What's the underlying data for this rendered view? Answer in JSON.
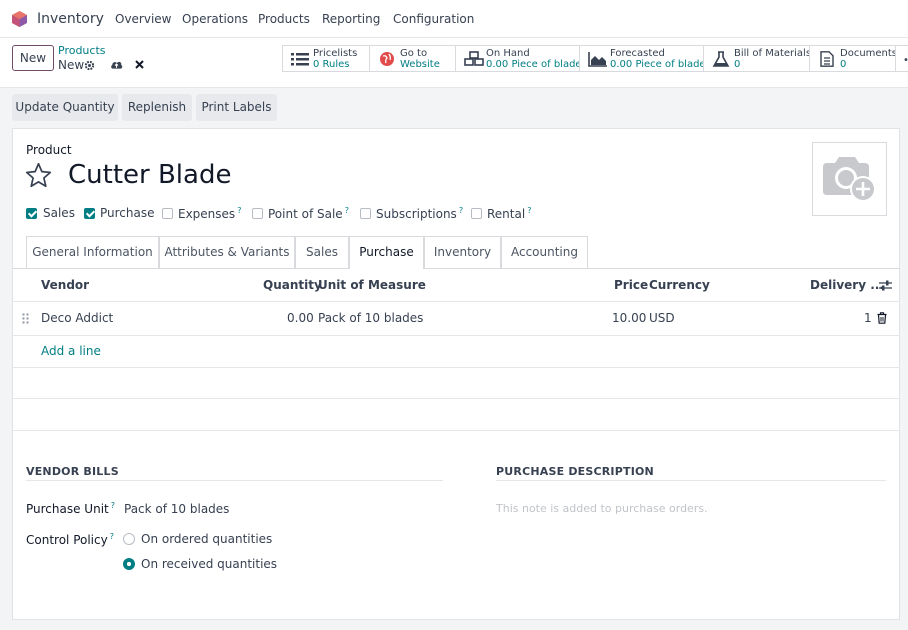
{
  "navbar": {
    "app_name": "Inventory",
    "menu": [
      "Overview",
      "Operations",
      "Products",
      "Reporting",
      "Configuration"
    ]
  },
  "control_panel": {
    "new_label": "New",
    "breadcrumb_parent": "Products",
    "breadcrumb_current": "New"
  },
  "smart_buttons": [
    {
      "title": "Pricelists",
      "value": "0 Rules",
      "icon": "list-icon"
    },
    {
      "title": "Go to",
      "value": "Website",
      "icon": "globe-icon"
    },
    {
      "title": "On Hand",
      "value": "0.00 Piece of blade",
      "icon": "cubes-icon"
    },
    {
      "title": "Forecasted",
      "value": "0.00 Piece of blade",
      "icon": "area-chart-icon"
    },
    {
      "title": "Bill of Materials",
      "value": "0",
      "icon": "flask-icon"
    },
    {
      "title": "Documents",
      "value": "0",
      "icon": "document-icon"
    }
  ],
  "actions": {
    "update_quantity": "Update Quantity",
    "replenish": "Replenish",
    "print_labels": "Print Labels"
  },
  "product": {
    "label": "Product",
    "name": "Cutter Blade",
    "options": [
      {
        "label": "Sales",
        "checked": true,
        "help": false
      },
      {
        "label": "Purchase",
        "checked": true,
        "help": false
      },
      {
        "label": "Expenses",
        "checked": false,
        "help": true
      },
      {
        "label": "Point of Sale",
        "checked": false,
        "help": true
      },
      {
        "label": "Subscriptions",
        "checked": false,
        "help": true
      },
      {
        "label": "Rental",
        "checked": false,
        "help": true
      }
    ],
    "help_mark": "?"
  },
  "tabs": [
    "General Information",
    "Attributes & Variants",
    "Sales",
    "Purchase",
    "Inventory",
    "Accounting"
  ],
  "active_tab": "Purchase",
  "vendor_table": {
    "columns": [
      "Vendor",
      "Quantity",
      "Unit of Measure",
      "Price",
      "Currency",
      "Delivery ..."
    ],
    "rows": [
      {
        "vendor": "Deco Addict",
        "quantity": "0.00",
        "uom": "Pack of 10 blades",
        "price": "10.00",
        "currency": "USD",
        "delivery": "1"
      }
    ],
    "add_line": "Add a line"
  },
  "vendor_bills": {
    "title": "VENDOR BILLS",
    "purchase_unit_label": "Purchase Unit",
    "purchase_unit_value": "Pack of 10 blades",
    "control_policy_label": "Control Policy",
    "policy_options": [
      {
        "label": "On ordered quantities",
        "selected": false
      },
      {
        "label": "On received quantities",
        "selected": true
      }
    ]
  },
  "purchase_description": {
    "title": "PURCHASE DESCRIPTION",
    "placeholder": "This note is added to purchase orders."
  },
  "colors": {
    "accent": "#017e84",
    "brand": "#714b67"
  }
}
